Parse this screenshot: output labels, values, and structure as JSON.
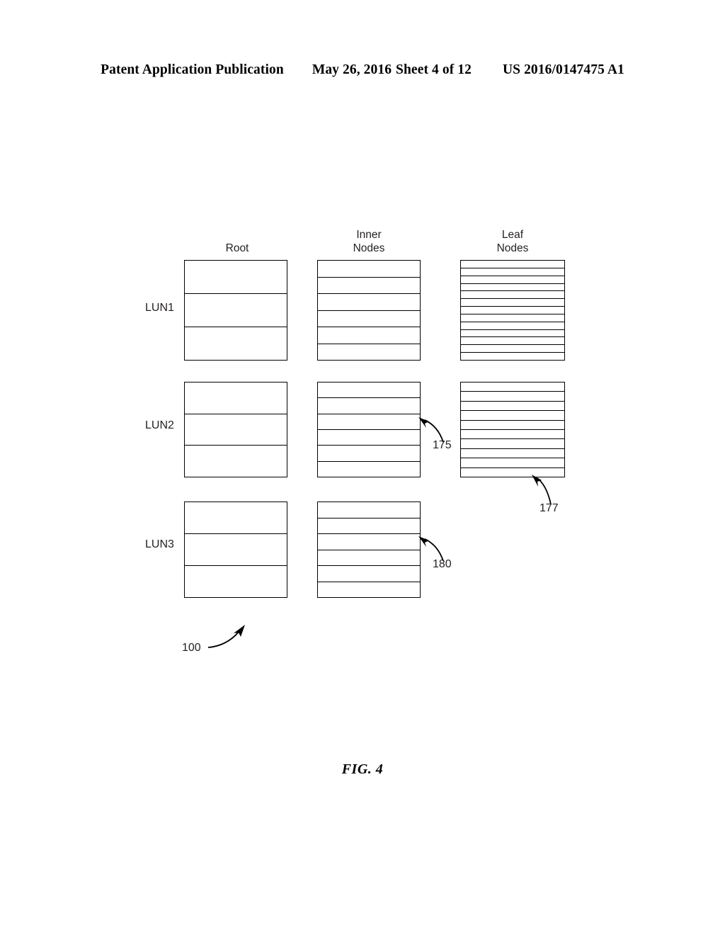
{
  "header": {
    "publication": "Patent Application Publication",
    "date": "May 26, 2016",
    "sheet": "Sheet 4 of 12",
    "patent_number": "US 2016/0147475 A1"
  },
  "figure": {
    "caption": "FIG. 4",
    "reference_numeral": "100",
    "columns": [
      {
        "id": "root",
        "label": "Root"
      },
      {
        "id": "inner",
        "label": "Inner\nNodes"
      },
      {
        "id": "leaf",
        "label": "Leaf\nNodes"
      }
    ],
    "rows": [
      {
        "label": "LUN1",
        "root_cells": 3,
        "inner_cells": 6,
        "leaf_cells": 13,
        "has_leaf": true
      },
      {
        "label": "LUN2",
        "root_cells": 3,
        "inner_cells": 6,
        "leaf_cells": 10,
        "has_leaf": true
      },
      {
        "label": "LUN3",
        "root_cells": 3,
        "inner_cells": 6,
        "leaf_cells": 0,
        "has_leaf": false
      }
    ],
    "callouts": [
      {
        "id": "175",
        "number": "175",
        "points_to": "lun2-inner-nodes"
      },
      {
        "id": "177",
        "number": "177",
        "points_to": "lun2-leaf-nodes"
      },
      {
        "id": "180",
        "number": "180",
        "points_to": "lun3-inner-nodes"
      },
      {
        "id": "100",
        "number": "100",
        "points_to": "figure-overall"
      }
    ]
  },
  "colors": {
    "ink": "#000000",
    "text": "#231f20",
    "background": "#ffffff"
  }
}
